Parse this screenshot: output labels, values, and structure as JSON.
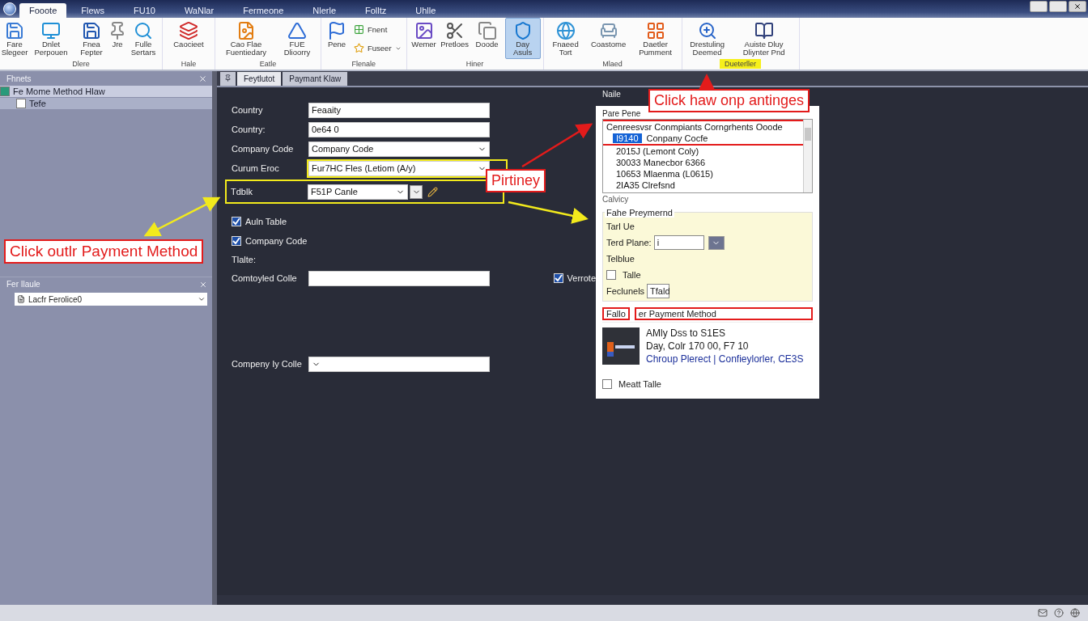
{
  "title_bar": {
    "tabs": [
      {
        "label": "Fooote",
        "selected": true
      },
      {
        "label": "Flews",
        "selected": false
      },
      {
        "label": "FU10",
        "selected": false
      },
      {
        "label": "WaNlar",
        "selected": false
      },
      {
        "label": "Fermeone",
        "selected": false
      },
      {
        "label": "Nlerle",
        "selected": false
      },
      {
        "label": "Folltz",
        "selected": false
      },
      {
        "label": "Uhlle",
        "selected": false
      }
    ]
  },
  "ribbon": {
    "groups": [
      {
        "label": "Dlere",
        "highlighted": false,
        "buttons": [
          {
            "kind": "large",
            "label": "Fare Slegeer",
            "selected": false
          },
          {
            "kind": "large",
            "label": "Dnlet Perpouen",
            "selected": false
          },
          {
            "kind": "large",
            "label": "Fnea Fepter",
            "selected": false
          },
          {
            "kind": "large",
            "label": "Jre",
            "selected": false
          },
          {
            "kind": "large",
            "label": "Fulle Sertars",
            "selected": false
          }
        ]
      },
      {
        "label": "Hale",
        "highlighted": false,
        "buttons": [
          {
            "kind": "large",
            "label": "Caocieet",
            "selected": false
          }
        ]
      },
      {
        "label": "Eatle",
        "highlighted": false,
        "buttons": [
          {
            "kind": "large",
            "label": "Cao Flae Fuentiedary",
            "selected": false
          },
          {
            "kind": "large",
            "label": "FUE Dlioorry",
            "selected": false
          }
        ]
      },
      {
        "label": "Flenale",
        "highlighted": false,
        "buttons": [
          {
            "kind": "large",
            "label": "Pene",
            "selected": false
          },
          {
            "kind": "small",
            "label": "Fnent",
            "selected": false
          },
          {
            "kind": "small",
            "label": "Fuseer",
            "selected": false
          }
        ]
      },
      {
        "label": "Hiner",
        "highlighted": false,
        "buttons": [
          {
            "kind": "large",
            "label": "Wemer",
            "selected": false
          },
          {
            "kind": "large",
            "label": "Pretloes",
            "selected": false
          },
          {
            "kind": "large",
            "label": "Doode",
            "selected": false
          },
          {
            "kind": "large",
            "label": "Day Asuls",
            "selected": true
          }
        ]
      },
      {
        "label": "Mlaed",
        "highlighted": false,
        "buttons": [
          {
            "kind": "large",
            "label": "Fnaeed Tort",
            "selected": false
          },
          {
            "kind": "large",
            "label": "Coastome",
            "selected": false
          },
          {
            "kind": "large",
            "label": "Daetler Pumment",
            "selected": false
          }
        ]
      },
      {
        "label": "Dueterller",
        "highlighted": true,
        "buttons": [
          {
            "kind": "large",
            "label": "Drestuling Deemed",
            "selected": false
          },
          {
            "kind": "large",
            "label": "Auiste Dluy Dliynter Pnd",
            "selected": false
          }
        ]
      }
    ]
  },
  "left_panel": {
    "title": "Fhnets",
    "tree": [
      {
        "label": "Fe Mome Method Hlaw",
        "selected": true,
        "expanded": true,
        "children": [
          {
            "label": "Tefe",
            "selected": false
          }
        ]
      }
    ],
    "section": {
      "title": "Fer Ilaule",
      "dropdown": {
        "value": "Lacfr Ferolice0"
      }
    }
  },
  "document_tabs": [
    {
      "label": "Feytlutot",
      "selected": true
    },
    {
      "label": "Paymant Klaw",
      "selected": false
    }
  ],
  "form": [
    {
      "kind": "text",
      "label": "Country",
      "value": "Feaaity"
    },
    {
      "kind": "text",
      "label": "Country:",
      "value": "0e64 0"
    },
    {
      "kind": "select",
      "label": "Company Code",
      "value": "Company Code"
    },
    {
      "kind": "select",
      "label": "Curum Eroc",
      "value": "Fur7HC Fles (Letiom (A/y)"
    },
    {
      "kind": "combo",
      "label": "Tdblk",
      "value": "F51P  Canle"
    },
    {
      "kind": "checkbox",
      "label": "Auln Table",
      "checked": true
    },
    {
      "kind": "checkbox",
      "label": "Company Code",
      "checked": true
    },
    {
      "kind": "heading",
      "label": "Tlalte:"
    },
    {
      "kind": "text",
      "label": "Comtoyled Colle",
      "side_checkbox": {
        "label": "Verrote",
        "checked": true
      }
    },
    {
      "kind": "select",
      "label": "Compeny Iy Colle"
    }
  ],
  "dialog": {
    "title": "Naile",
    "list_label": "Pare Pene",
    "list": [
      {
        "text": "Cenreesvsr  Conmpiants Corngrhents Ooode",
        "selected": false
      },
      {
        "code": "I9140",
        "text": "Conpany Cocfe",
        "selected": true
      },
      {
        "text": "2015J (Lemont Coly)",
        "selected": false
      },
      {
        "text": "30033 Manecbor 6366",
        "selected": false
      },
      {
        "text": "10653 Mlaenma (L0615)",
        "selected": false
      },
      {
        "text": "2IA35 Clrefsnd",
        "selected": false
      }
    ],
    "list_caption": "Calvicy",
    "fieldset": {
      "title": "Fahe Preymernd",
      "rows": [
        {
          "kind": "label",
          "label": "Tarl Ue"
        },
        {
          "kind": "field",
          "label": "Terd Plane:",
          "value": "i"
        },
        {
          "kind": "label",
          "label": "Telblue"
        },
        {
          "kind": "checkbox",
          "label": "Talle",
          "checked": false
        },
        {
          "kind": "small_field",
          "label": "Feclunels",
          "value": "Tfald"
        }
      ]
    },
    "section_left": "Fallo",
    "section_title": "er Payment Method",
    "card": {
      "lines": [
        "AMly Dss to S1ES",
        "Day, Colr 170 00, F7 10"
      ],
      "link": "Chroup Plerect | Confieylorler, CE3S"
    },
    "checkbox": {
      "label": "Meatt Talle",
      "checked": false
    }
  },
  "annotations": [
    {
      "text": "Click outlr Payment Method"
    },
    {
      "text": "Click haw onp antinges"
    },
    {
      "text": "Pirtiney"
    }
  ]
}
